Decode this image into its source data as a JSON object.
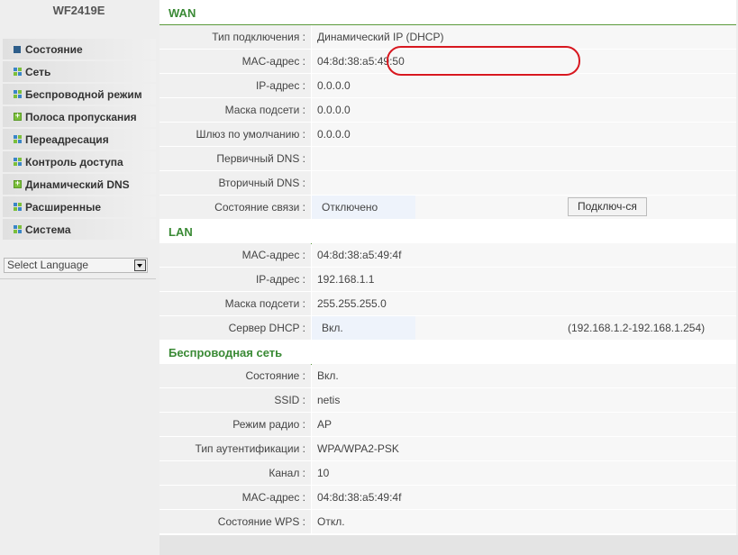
{
  "sidebar": {
    "model": "WF2419E",
    "items": [
      {
        "label": "Состояние",
        "icon": "arrow-right-icon"
      },
      {
        "label": "Сеть",
        "icon": "grid-icon"
      },
      {
        "label": "Беспроводной режим",
        "icon": "grid-icon"
      },
      {
        "label": "Полоса пропускания",
        "icon": "plus-icon"
      },
      {
        "label": "Переадресация",
        "icon": "grid-icon"
      },
      {
        "label": "Контроль доступа",
        "icon": "grid-icon"
      },
      {
        "label": "Динамический DNS",
        "icon": "plus-icon"
      },
      {
        "label": "Расширенные",
        "icon": "grid-icon"
      },
      {
        "label": "Система",
        "icon": "grid-icon"
      }
    ],
    "language_select": "Select Language"
  },
  "wan": {
    "title": "WAN",
    "rows": [
      {
        "label": "Тип подключения :",
        "value": "Динамический IP (DHCP)"
      },
      {
        "label": "MAC-адрес :",
        "value": "04:8d:38:a5:49:50"
      },
      {
        "label": "IP-адрес :",
        "value": "0.0.0.0"
      },
      {
        "label": "Маска подсети :",
        "value": "0.0.0.0"
      },
      {
        "label": "Шлюз по умолчанию :",
        "value": "0.0.0.0"
      },
      {
        "label": "Первичный DNS :",
        "value": ""
      },
      {
        "label": "Вторичный DNS :",
        "value": ""
      },
      {
        "label": "Состояние связи :",
        "value": "Отключено"
      }
    ],
    "connect_button": "Подключ-ся"
  },
  "lan": {
    "title": "LAN",
    "rows": [
      {
        "label": "MAC-адрес :",
        "value": "04:8d:38:a5:49:4f"
      },
      {
        "label": "IP-адрес :",
        "value": "192.168.1.1"
      },
      {
        "label": "Маска подсети :",
        "value": "255.255.255.0"
      },
      {
        "label": "Сервер DHCP :",
        "value": "Вкл."
      }
    ],
    "dhcp_range": "(192.168.1.2-192.168.1.254)"
  },
  "wireless": {
    "title": "Беспроводная сеть",
    "rows": [
      {
        "label": "Состояние :",
        "value": "Вкл."
      },
      {
        "label": "SSID :",
        "value": "netis"
      },
      {
        "label": "Режим радио :",
        "value": "AP"
      },
      {
        "label": "Тип аутентификации :",
        "value": "WPA/WPA2-PSK"
      },
      {
        "label": "Канал :",
        "value": "10"
      },
      {
        "label": "MAC-адрес :",
        "value": "04:8d:38:a5:49:4f"
      },
      {
        "label": "Состояние WPS :",
        "value": "Откл."
      }
    ]
  },
  "colors": {
    "accent": "#3a8a35",
    "highlight": "#d81820"
  }
}
